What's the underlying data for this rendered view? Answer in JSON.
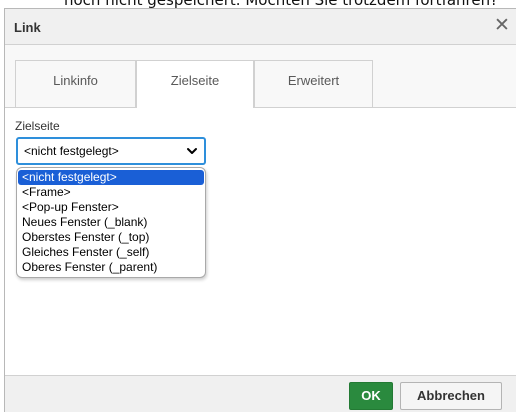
{
  "header_cutoff": "noch nicht gespeichert. Möchten Sie trotzdem fortfahren?",
  "dialog": {
    "title": "Link",
    "close_icon": "close-icon"
  },
  "tabs": [
    {
      "label": "Linkinfo",
      "active": false
    },
    {
      "label": "Zielseite",
      "active": true
    },
    {
      "label": "Erweitert",
      "active": false
    }
  ],
  "target": {
    "label": "Zielseite",
    "selected_value": "<nicht festgelegt>",
    "options": [
      "<nicht festgelegt>",
      "<Frame>",
      "<Pop-up Fenster>",
      "Neues Fenster (_blank)",
      "Oberstes Fenster (_top)",
      "Gleiches Fenster (_self)",
      "Oberes Fenster (_parent)"
    ]
  },
  "footer": {
    "ok_label": "OK",
    "cancel_label": "Abbrechen"
  },
  "colors": {
    "accent_focus": "#2e8fdb",
    "selection": "#1a5fd6",
    "ok_button": "#2a8a3e"
  }
}
